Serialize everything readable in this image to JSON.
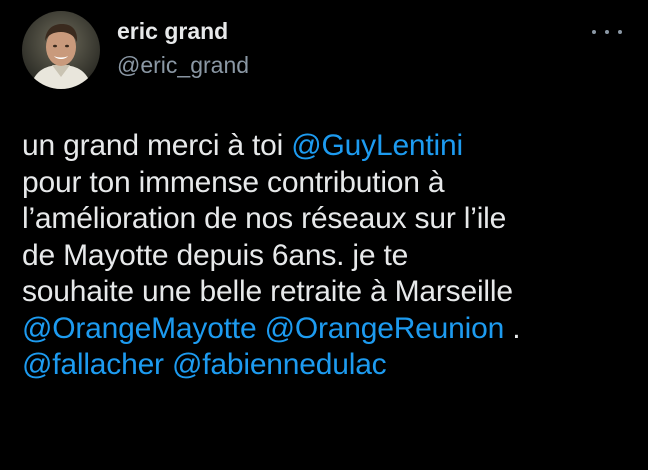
{
  "author": {
    "display_name": "eric grand",
    "handle": "@eric_grand"
  },
  "more_icon": "more-horizontal-icon",
  "tweet": {
    "lines": [
      [
        "un grand merci à toi ",
        "@GuyLentini"
      ],
      [
        "pour ton immense contribution à"
      ],
      [
        "l’amélioration de nos réseaux sur l’ile"
      ],
      [
        "de Mayotte depuis 6ans. je te"
      ],
      [
        "souhaite une belle retraite à Marseille"
      ],
      [
        "@OrangeMayotte",
        " ",
        "@OrangeReunion",
        " ."
      ],
      [
        "@fallacher",
        " ",
        "@fabiennedulac"
      ]
    ]
  },
  "colors": {
    "background": "#000000",
    "text": "#e7e9ea",
    "secondary": "#8b98a5",
    "mention": "#1d9bf0"
  }
}
